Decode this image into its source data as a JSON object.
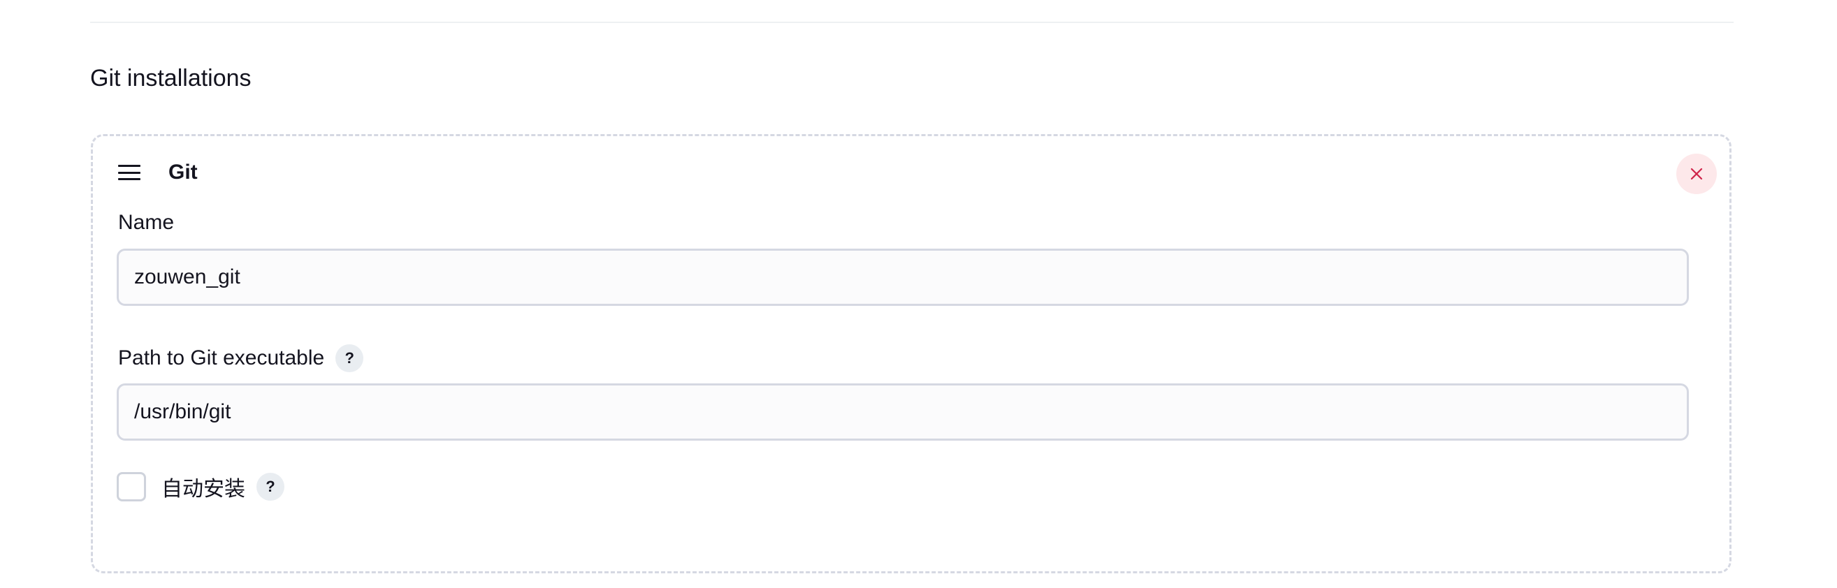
{
  "section": {
    "title": "Git installations"
  },
  "installation": {
    "title": "Git",
    "name_label": "Name",
    "name_value": "zouwen_git",
    "path_label": "Path to Git executable",
    "path_value": "/usr/bin/git",
    "auto_install_label": "自动安装",
    "auto_install_checked": false,
    "help_glyph": "?",
    "icons": {
      "drag": "drag-handle-icon",
      "delete": "close-icon"
    },
    "colors": {
      "delete_icon": "#d0244a",
      "delete_bg": "#fde8ea",
      "border": "#d5d8e2"
    }
  }
}
